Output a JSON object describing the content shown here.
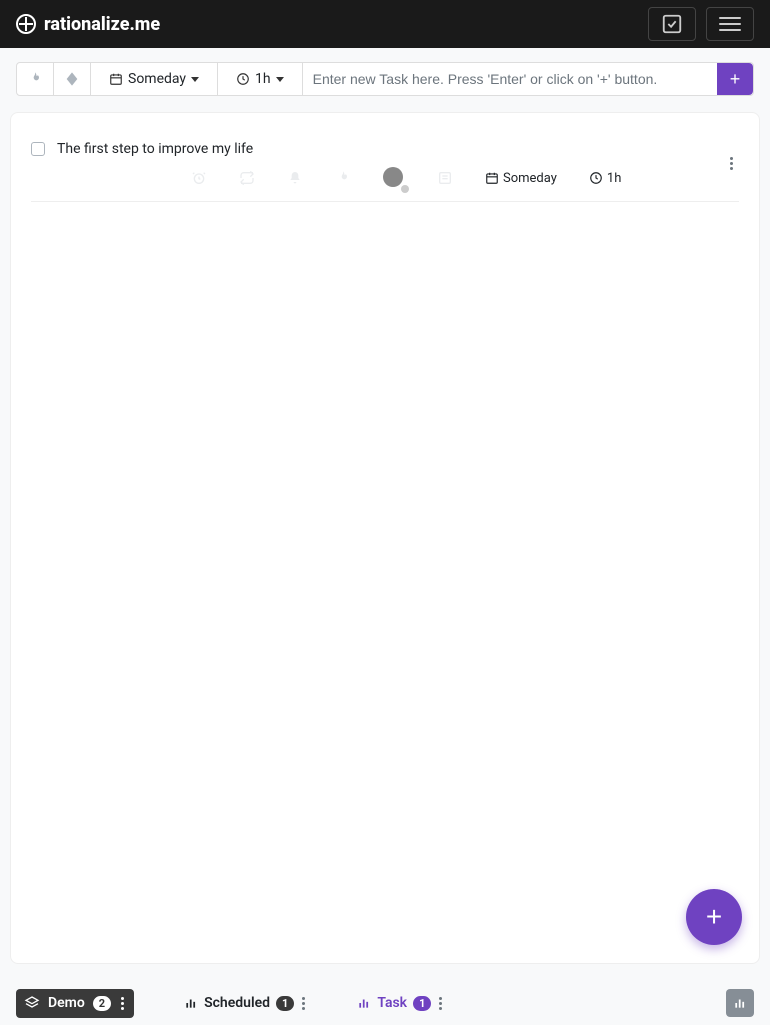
{
  "header": {
    "brand": "rationalize.me"
  },
  "toolbar": {
    "schedule_label": "Someday",
    "duration_label": "1h",
    "new_task_placeholder": "Enter new Task here. Press 'Enter' or click on '+' button.",
    "add_label": "+"
  },
  "tasks": [
    {
      "title": "The first step to improve my life",
      "schedule": "Someday",
      "duration": "1h"
    }
  ],
  "fab": {
    "label": "+"
  },
  "footer": {
    "demo": {
      "label": "Demo",
      "count": "2"
    },
    "scheduled": {
      "label": "Scheduled",
      "count": "1"
    },
    "task": {
      "label": "Task",
      "count": "1"
    }
  }
}
